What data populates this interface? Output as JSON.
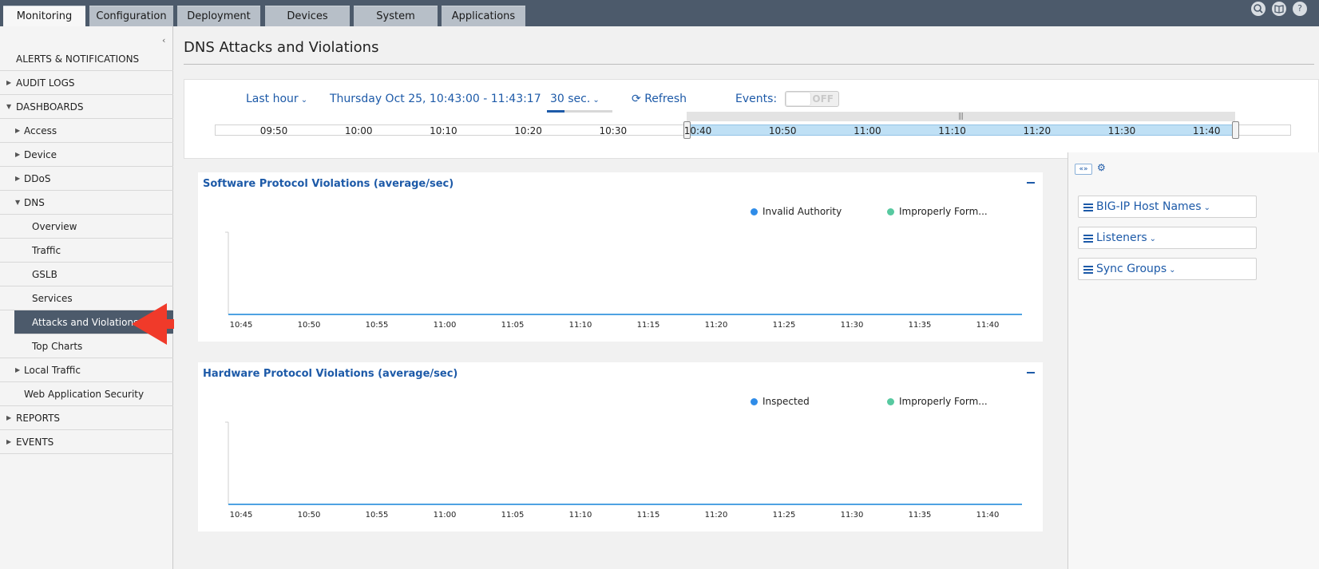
{
  "top_nav": {
    "tabs": [
      {
        "label": "Monitoring",
        "active": true
      },
      {
        "label": "Configuration",
        "active": false
      },
      {
        "label": "Deployment",
        "active": false
      },
      {
        "label": "Devices",
        "active": false
      },
      {
        "label": "System",
        "active": false
      },
      {
        "label": "Applications",
        "active": false
      }
    ],
    "icons": [
      "search-icon",
      "book-icon",
      "help-icon"
    ]
  },
  "sidebar": {
    "items": [
      {
        "label": "ALERTS & NOTIFICATIONS",
        "expander": "none"
      },
      {
        "label": "AUDIT LOGS",
        "expander": "collapsed"
      },
      {
        "label": "DASHBOARDS",
        "expander": "expanded"
      },
      {
        "label": "Access",
        "expander": "collapsed"
      },
      {
        "label": "Device",
        "expander": "collapsed"
      },
      {
        "label": "DDoS",
        "expander": "collapsed"
      },
      {
        "label": "DNS",
        "expander": "expanded"
      },
      {
        "label": "Overview",
        "expander": "none"
      },
      {
        "label": "Traffic",
        "expander": "none"
      },
      {
        "label": "GSLB",
        "expander": "none"
      },
      {
        "label": "Services",
        "expander": "none"
      },
      {
        "label": "Attacks and Violations",
        "expander": "none",
        "selected": true
      },
      {
        "label": "Top Charts",
        "expander": "none"
      },
      {
        "label": "Local Traffic",
        "expander": "collapsed"
      },
      {
        "label": "Web Application Security",
        "expander": "none"
      },
      {
        "label": "REPORTS",
        "expander": "collapsed"
      },
      {
        "label": "EVENTS",
        "expander": "collapsed"
      }
    ]
  },
  "page": {
    "title": "DNS Attacks and Violations"
  },
  "time_controls": {
    "range": "Last hour",
    "date_range": "Thursday Oct 25, 10:43:00 - 11:43:17",
    "interval": "30 sec.",
    "refresh": "Refresh",
    "events_label": "Events:",
    "events_toggle": "OFF",
    "timeline_ticks": [
      "09:50",
      "10:00",
      "10:10",
      "10:20",
      "10:30",
      "10:40",
      "10:50",
      "11:00",
      "11:10",
      "11:20",
      "11:30",
      "11:40"
    ]
  },
  "colors": {
    "accent": "#1d5aa8",
    "nav_dark": "#4c5a6b",
    "series_blue": "#2f8ce8",
    "series_green": "#57c9a0",
    "annotation_red": "#f03a2a"
  },
  "chart_data": [
    {
      "type": "line",
      "title": "Software Protocol Violations (average/sec)",
      "xlabel": "",
      "ylabel": "",
      "x": [
        "10:45",
        "10:50",
        "10:55",
        "11:00",
        "11:05",
        "11:10",
        "11:15",
        "11:20",
        "11:25",
        "11:30",
        "11:35",
        "11:40"
      ],
      "series": [
        {
          "name": "Invalid Authority",
          "color": "#2f8ce8",
          "values": [
            0,
            0,
            0,
            0,
            0,
            0,
            0,
            0,
            0,
            0,
            0,
            0
          ]
        },
        {
          "name": "Improperly Form...",
          "color": "#57c9a0",
          "values": [
            0,
            0,
            0,
            0,
            0,
            0,
            0,
            0,
            0,
            0,
            0,
            0
          ]
        }
      ],
      "legend": "top-right"
    },
    {
      "type": "line",
      "title": "Hardware Protocol Violations (average/sec)",
      "xlabel": "",
      "ylabel": "",
      "x": [
        "10:45",
        "10:50",
        "10:55",
        "11:00",
        "11:05",
        "11:10",
        "11:15",
        "11:20",
        "11:25",
        "11:30",
        "11:35",
        "11:40"
      ],
      "series": [
        {
          "name": "Inspected",
          "color": "#2f8ce8",
          "values": [
            0,
            0,
            0,
            0,
            0,
            0,
            0,
            0,
            0,
            0,
            0,
            0
          ]
        },
        {
          "name": "Improperly Form...",
          "color": "#57c9a0",
          "values": [
            0,
            0,
            0,
            0,
            0,
            0,
            0,
            0,
            0,
            0,
            0,
            0
          ]
        }
      ],
      "legend": "top-right"
    }
  ],
  "filters": {
    "items": [
      {
        "label": "BIG-IP Host Names"
      },
      {
        "label": "Listeners"
      },
      {
        "label": "Sync Groups"
      }
    ]
  }
}
